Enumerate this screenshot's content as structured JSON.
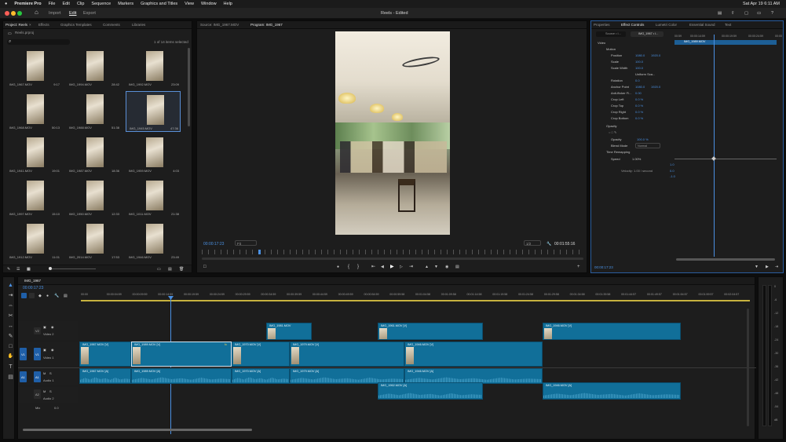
{
  "menubar": {
    "apple": "",
    "app": "Premiere Pro",
    "items": [
      "File",
      "Edit",
      "Clip",
      "Sequence",
      "Markers",
      "Graphics and Titles",
      "View",
      "Window",
      "Help"
    ],
    "datetime": "Sat Apr 19  6:11 AM"
  },
  "header": {
    "tabs": [
      "Import",
      "Edit",
      "Export"
    ],
    "active_tab": "Edit",
    "title": "Reels - Edited"
  },
  "project": {
    "tabs": [
      "Project: Reels",
      "Effects",
      "Graphics Templates",
      "Comments",
      "Libraries"
    ],
    "file": "Reels.prproj",
    "selection": "1 of 14 items selected",
    "search_placeholder": "",
    "bins": [
      {
        "name": "IMG_1967.MOV",
        "duration": "9:17"
      },
      {
        "name": "IMG_1994.MOV",
        "duration": "28:42"
      },
      {
        "name": "IMG_1992.MOV",
        "duration": "23:09"
      },
      {
        "name": "IMG_1968.MOV",
        "duration": "50:13"
      },
      {
        "name": "IMG_1988.MOV",
        "duration": "51:38"
      },
      {
        "name": "IMG_1945.MOV",
        "duration": "47:36"
      },
      {
        "name": "IMG_1941.MOV",
        "duration": "19:01"
      },
      {
        "name": "IMG_1987.MOV",
        "duration": "18:36"
      },
      {
        "name": "IMG_1959.MOV",
        "duration": "4:03"
      },
      {
        "name": "IMG_1997.MOV",
        "duration": "15:10"
      },
      {
        "name": "IMG_1950.MOV",
        "duration": "12:33"
      },
      {
        "name": "IMG_1011.MOV",
        "duration": "21:38"
      },
      {
        "name": "IMG_1912.MOV",
        "duration": "11:01"
      },
      {
        "name": "IMG_2014.MOV",
        "duration": "17:53"
      },
      {
        "name": "IMG_1946.MOV",
        "duration": "23:49"
      }
    ]
  },
  "program": {
    "tabs": [
      "Source: IMG_1967.MOV",
      "Program: IMG_1967"
    ],
    "timecode": "00:00:17:23",
    "fit": "Fit",
    "ratio": "1/2",
    "duration": "00:01:55:16"
  },
  "effects": {
    "tabs": [
      "Properties",
      "Effect Controls",
      "Lumetri Color",
      "Essential Sound",
      "Text"
    ],
    "source": "Source • I...",
    "clip": "IMG_1967 • I...",
    "mini_times": [
      "00:59",
      "00:00:14:59",
      "00:00:19:59",
      "00:00:24:59",
      "00:00"
    ],
    "clip_bar": "IMG_1989.MOV",
    "video_label": "Video",
    "motion": "Motion",
    "rows": [
      {
        "label": "Position",
        "v1": "1080.0",
        "v2": "1920.0"
      },
      {
        "label": "Scale",
        "v1": "100.0",
        "v2": ""
      },
      {
        "label": "Scale Width",
        "v1": "100.0",
        "v2": ""
      },
      {
        "label": "",
        "v1": "Uniform Sca...",
        "v2": ""
      },
      {
        "label": "Rotation",
        "v1": "0.0",
        "v2": ""
      },
      {
        "label": "Anchor Point",
        "v1": "1080.0",
        "v2": "1920.0"
      },
      {
        "label": "Anti-flicker Fi...",
        "v1": "0.00",
        "v2": ""
      },
      {
        "label": "Crop Left",
        "v1": "0.0 %",
        "v2": ""
      },
      {
        "label": "Crop Top",
        "v1": "0.0 %",
        "v2": ""
      },
      {
        "label": "Crop Right",
        "v1": "0.0 %",
        "v2": ""
      },
      {
        "label": "Crop Bottom",
        "v1": "0.0 %",
        "v2": ""
      }
    ],
    "opacity_title": "Opacity",
    "opacity_label": "Opacity",
    "opacity_value": "100.0 %",
    "blend_label": "Blend Mode",
    "blend_value": "Normal",
    "time_remap": "Time Remapping",
    "speed_label": "Speed",
    "speed_value": "1.00%",
    "velocity": "Velocity: 1.00 / second",
    "g_top": "1.0",
    "g_mid": "0.0",
    "g_bot": "-1.0",
    "timecode": "00:00:17:23"
  },
  "timeline": {
    "tab": "IMG_1967",
    "timecode": "00:00:17:23",
    "ruler": [
      "00:00",
      "00:00:04:59",
      "00:00:09:59",
      "00:00:14:59",
      "00:00:19:59",
      "00:00:24:59",
      "00:00:29:59",
      "00:00:34:59",
      "00:00:39:59",
      "00:00:44:59",
      "00:00:49:59",
      "00:00:54:59",
      "00:00:59:58",
      "00:01:04:58",
      "00:01:09:58",
      "00:01:14:58",
      "00:01:19:58",
      "00:01:24:58",
      "00:01:29:58",
      "00:01:34:58",
      "00:01:39:58",
      "00:01:44:57",
      "00:01:49:57",
      "00:01:54:57",
      "00:01:59:57",
      "00:02:04:57"
    ],
    "tracks": {
      "v2": "V2",
      "v2n": "Video 2",
      "v1": "V1",
      "v1n": "Video 1",
      "v1src": "V1",
      "a1": "A1",
      "a1n": "Audio 1",
      "a1src": "A1",
      "a2": "A2",
      "a2n": "Audio 2",
      "mix": "Mix",
      "mixv": "0.0"
    },
    "clips": {
      "v2a": "IMG_1981.MOV",
      "v2b": "IMG_1961.MOV [V]",
      "v2c": "IMG_1946.MOV [V]",
      "v1a": "IMG_1967.MOV [V]",
      "v1b": "IMG_1989.MOV [V]",
      "v1fx": "fx",
      "v1c": "IMG_1970.MOV [V]",
      "v1d": "IMG_1979.MOV [V]",
      "v1e": "IMG_1946.MOV [V]",
      "a1a": "IMG_1967.MOV [A]",
      "a1b": "IMG_1989.MOV [A]",
      "a1c": "IMG_1970.MOV [A]",
      "a1d": "IMG_1979.MOV [A]",
      "a1e": "IMG_1946.MOV [A]",
      "a2a": "IMG_1962.MOV [A]",
      "a2b": "IMG_1946.MOV [A]"
    }
  },
  "meter": [
    "0",
    "-6",
    "-12",
    "-18",
    "-24",
    "-30",
    "-36",
    "-42",
    "-48",
    "-54",
    "dB"
  ],
  "icons": {
    "home": "⌂",
    "close": "×",
    "search": "⌕",
    "folder": "▭",
    "gear": "⚙",
    "list": "☰",
    "grid": "▦",
    "trash": "🗑",
    "select": "▲",
    "track": "⇥",
    "ripple": "⇔",
    "razor": "✂",
    "slip": "↔",
    "pen": "✎",
    "rect": "□",
    "hand": "✋",
    "text": "T",
    "play": "▶",
    "stepback": "◀",
    "stepfwd": "▷",
    "mark_in": "{",
    "mark_out": "}",
    "goin": "⇤",
    "goout": "⇥",
    "lift": "▲",
    "extract": "▼",
    "camera": "◉",
    "compare": "▤",
    "plus": "+",
    "wrench": "🔧",
    "marker": "●",
    "eye": "◉",
    "lock": "▣",
    "speaker": "🔊",
    "chev": "▸"
  }
}
